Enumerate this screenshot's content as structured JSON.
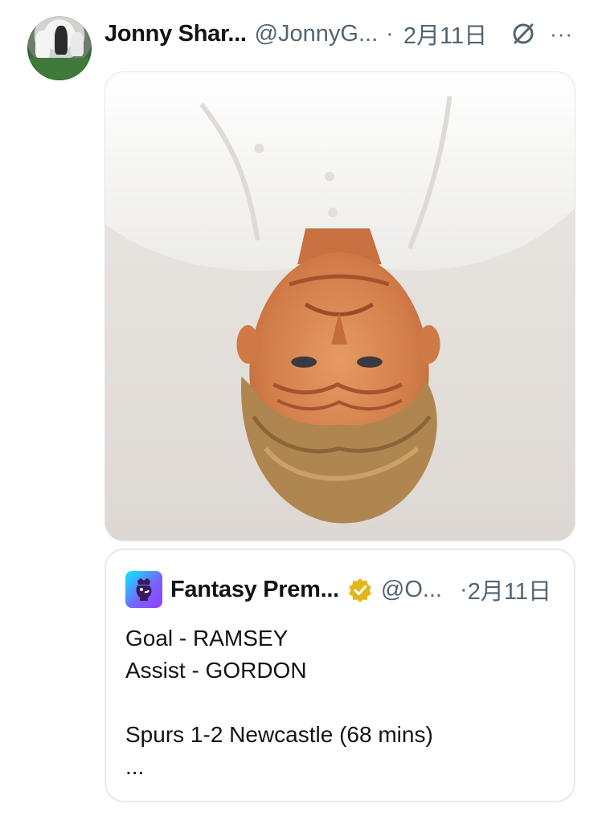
{
  "tweet": {
    "author_name": "Jonny Shar...",
    "author_handle": "@JonnyG...",
    "separator": "·",
    "date": "2月11日",
    "more_label": "···"
  },
  "quote": {
    "author_name": "Fantasy Prem...",
    "author_handle": "@O...",
    "separator": "·",
    "date": "2月11日",
    "lines": [
      "Goal - RAMSEY",
      "Assist - GORDON",
      "",
      "Spurs 1-2 Newcastle (68 mins)",
      "..."
    ]
  },
  "icons": {
    "avatar": "profile-photo",
    "edit_indicator": "no-edit-icon",
    "more": "more-icon",
    "quote_logo": "premier-league-lion-logo",
    "verified": "gold-verified-badge"
  },
  "colors": {
    "text_primary": "#0f1419",
    "text_secondary": "#536471",
    "border": "#e6eaed",
    "verified_gold": "#e2b719"
  }
}
